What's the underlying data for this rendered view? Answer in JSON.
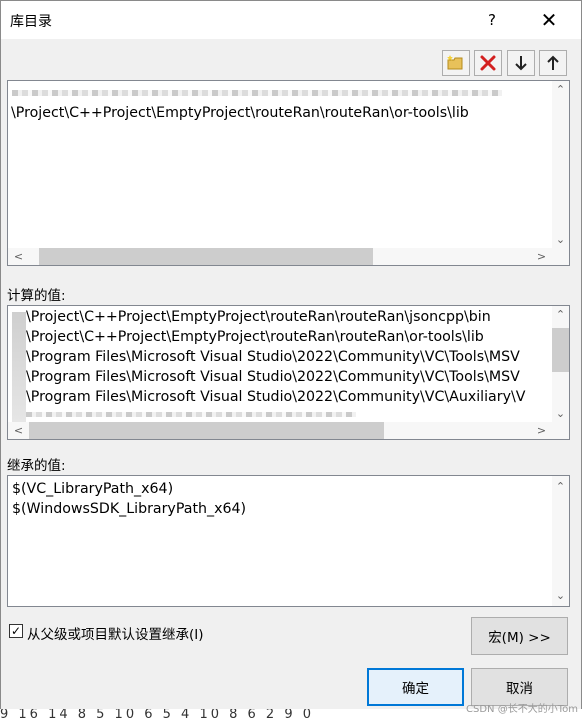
{
  "dialog": {
    "title": "库目录",
    "help": "?",
    "close": "✕"
  },
  "toolbar": {
    "new_line_icon": "folder-new-icon",
    "delete_icon": "delete-icon",
    "move_down_icon": "arrow-down-icon",
    "move_up_icon": "arrow-up-icon"
  },
  "editor": {
    "lines": [
      "\\Project\\C++Project\\EmptyProject\\routeRan\\routeRan\\or-tools\\lib"
    ]
  },
  "computed": {
    "label": "计算的值:",
    "lines": [
      "\\Project\\C++Project\\EmptyProject\\routeRan\\routeRan\\jsoncpp\\bin",
      "\\Project\\C++Project\\EmptyProject\\routeRan\\routeRan\\or-tools\\lib",
      "\\Program Files\\Microsoft Visual Studio\\2022\\Community\\VC\\Tools\\MSV",
      "\\Program Files\\Microsoft Visual Studio\\2022\\Community\\VC\\Tools\\MSV",
      "\\Program Files\\Microsoft Visual Studio\\2022\\Community\\VC\\Auxiliary\\V"
    ]
  },
  "inherited": {
    "label": "继承的值:",
    "lines": [
      "$(VC_LibraryPath_x64)",
      "$(WindowsSDK_LibraryPath_x64)"
    ]
  },
  "inherit_checkbox": {
    "label": "从父级或项目默认设置继承(I)",
    "checked": true
  },
  "buttons": {
    "macro": "宏(M) >>",
    "ok": "确定",
    "cancel": "取消"
  },
  "background_strip": "9 16 14 8 5 10 6 5 4 10 8 6 2 9 0",
  "watermark": "CSDN @长不大的小Tom"
}
